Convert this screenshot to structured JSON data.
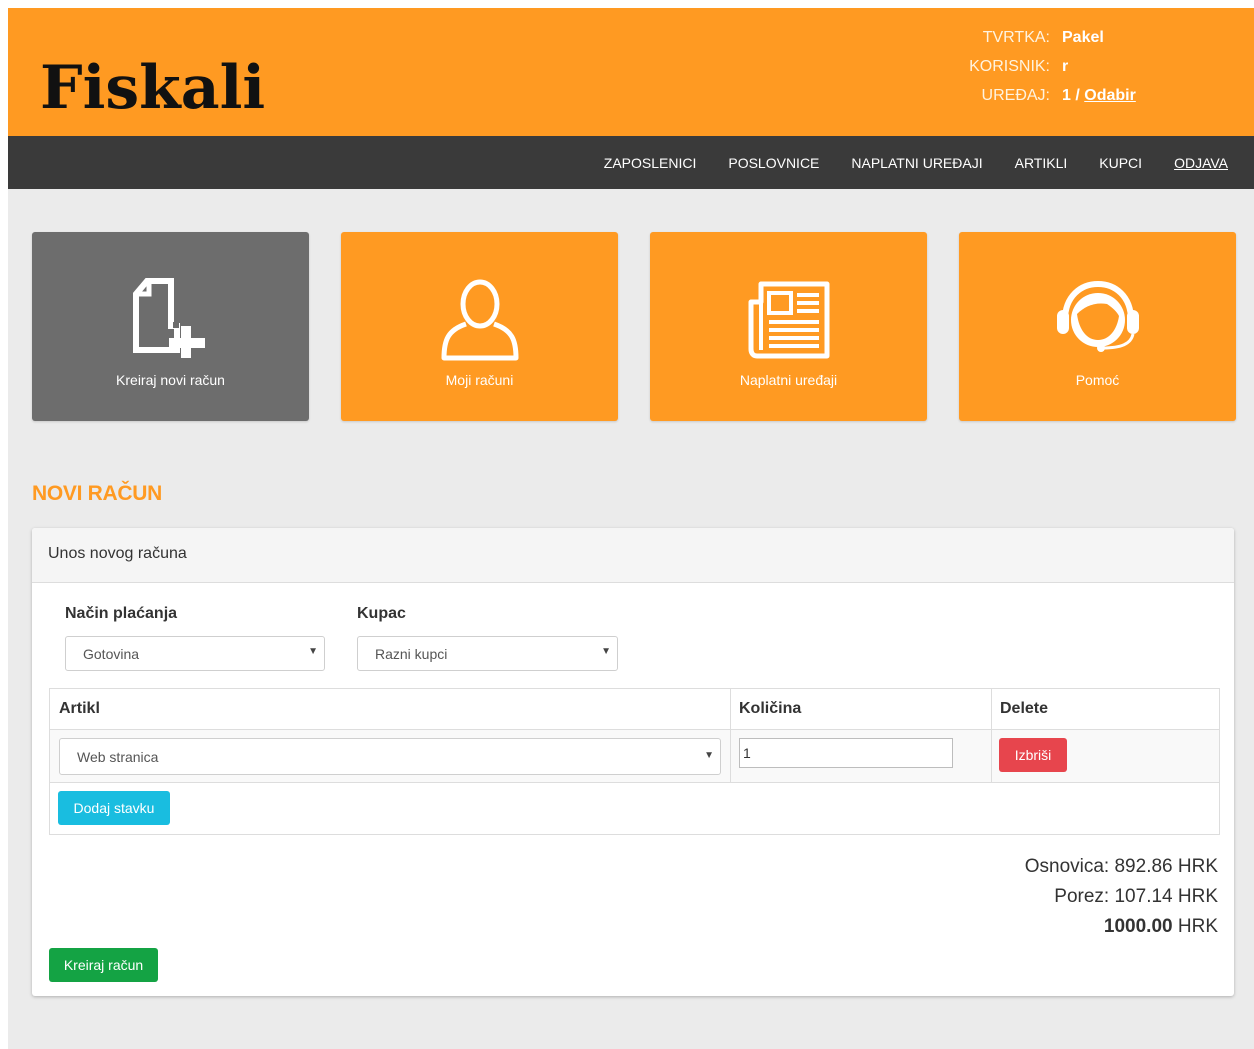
{
  "header": {
    "logo": "Fiskali",
    "company_label": "TVRTKA:",
    "company_value": "Pakel",
    "user_label": "KORISNIK:",
    "user_value": "r",
    "device_label": "UREĐAJ:",
    "device_value": "1 /",
    "device_link": "Odabir"
  },
  "nav": {
    "items": [
      "ZAPOSLENICI",
      "POSLOVNICE",
      "NAPLATNI UREĐAJI",
      "ARTIKLI",
      "KUPCI",
      "ODJAVA"
    ]
  },
  "tiles": [
    {
      "label": "Kreiraj novi račun",
      "icon": "new-document-plus-icon"
    },
    {
      "label": "Moji računi",
      "icon": "user-icon"
    },
    {
      "label": "Naplatni uređaji",
      "icon": "newspaper-icon"
    },
    {
      "label": "Pomoć",
      "icon": "headset-support-icon"
    }
  ],
  "section_title": "NOVI RAČUN",
  "panel": {
    "heading": "Unos novog računa",
    "payment_label": "Način plaćanja",
    "payment_value": "Gotovina",
    "customer_label": "Kupac",
    "customer_value": "Razni kupci",
    "table": {
      "col_article": "Artikl",
      "col_qty": "Količina",
      "col_delete": "Delete",
      "row_article": "Web stranica",
      "row_qty": "1",
      "delete_btn": "Izbriši"
    },
    "add_item_btn": "Dodaj stavku",
    "totals": {
      "base": "Osnovica: 892.86 HRK",
      "tax": "Porez: 107.14 HRK",
      "total_value": "1000.00",
      "total_currency": "HRK"
    },
    "create_btn": "Kreiraj račun"
  },
  "colors": {
    "brand_orange": "#ff9a22",
    "nav_dark": "#3a3a3a",
    "tile_dark": "#6d6d6d",
    "danger": "#e7454d",
    "info": "#19bde0",
    "success": "#14a344"
  }
}
